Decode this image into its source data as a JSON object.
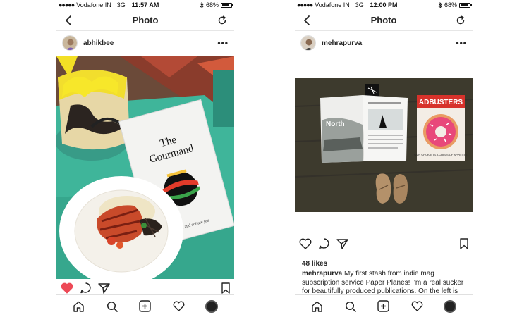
{
  "status_bar": {
    "carrier": "Vodafone IN",
    "network": "3G",
    "battery": "68%",
    "battery_level": 0.68
  },
  "screens": [
    {
      "time": "11:57 AM",
      "title": "Photo",
      "username": "abhikbee",
      "liked": true,
      "magazine_title_line1": "The",
      "magazine_title_line2": "Gourmand",
      "magazine_subtitle": "A food and culture jou"
    },
    {
      "time": "12:00 PM",
      "title": "Photo",
      "username": "mehrapurva",
      "liked": false,
      "likes": "48 likes",
      "caption_user": "mehrapurva",
      "caption_text": "My first stash from indie mag subscription service Paper Planes! I'm a real sucker for beautifully produced publications. On the left is",
      "magazine_spread_word": "North",
      "magazine_cover_title": "ADBUSTERS",
      "magazine_cover_subtitle": "OUR CHOICE IS A CRISIS OF APPETITE"
    }
  ],
  "colors": {
    "like_red": "#ed4956",
    "text": "#262626",
    "divider": "#e6e6e6"
  },
  "icons": {
    "back": "chevron-left-icon",
    "refresh": "refresh-icon",
    "more": "more-options-icon",
    "heart": "heart-icon",
    "comment": "comment-icon",
    "share": "send-icon",
    "bookmark": "bookmark-icon",
    "home": "home-icon",
    "search": "search-icon",
    "add": "add-icon",
    "activity": "activity-heart-icon",
    "profile": "profile-avatar"
  }
}
